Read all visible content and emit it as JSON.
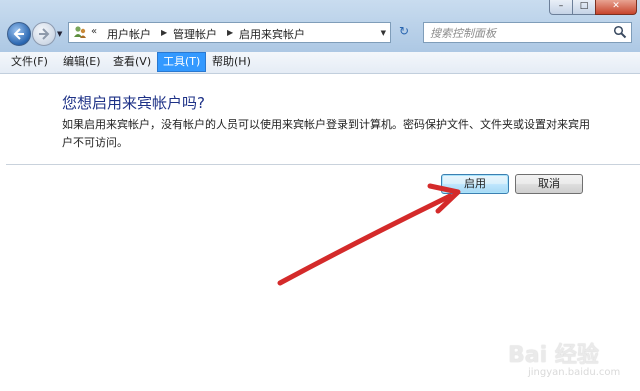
{
  "window": {
    "controls": {
      "minimize": "–",
      "maximize": "□",
      "close": "✕"
    }
  },
  "nav": {
    "back_icon": "back-arrow-icon",
    "forward_icon": "forward-arrow-icon",
    "history_dropdown_icon": "chevron-down-icon"
  },
  "address": {
    "icon": "users-icon",
    "overflow": "«",
    "breadcrumbs": [
      "用户帐户",
      "管理帐户",
      "启用来宾帐户"
    ],
    "separator": "▶",
    "dropdown": "▼",
    "refresh_icon": "↻"
  },
  "search": {
    "placeholder": "搜索控制面板",
    "icon": "search-icon"
  },
  "menu": {
    "items": [
      "文件(F)",
      "编辑(E)",
      "查看(V)",
      "工具(T)",
      "帮助(H)"
    ],
    "active_index": 3
  },
  "main": {
    "heading": "您想启用来宾帐户吗?",
    "description": "如果启用来宾帐户，没有帐户的人员可以使用来宾帐户登录到计算机。密码保护文件、文件夹或设置对来宾用户不可访问。",
    "enable_button": "启用",
    "cancel_button": "取消"
  },
  "annotation": {
    "arrow_color": "#d42a2a"
  },
  "watermark": {
    "main": "Bai 经验",
    "sub": "jingyan.baidu.com"
  },
  "colors": {
    "heading": "#1e3287",
    "menu_active": "#3399ff"
  }
}
